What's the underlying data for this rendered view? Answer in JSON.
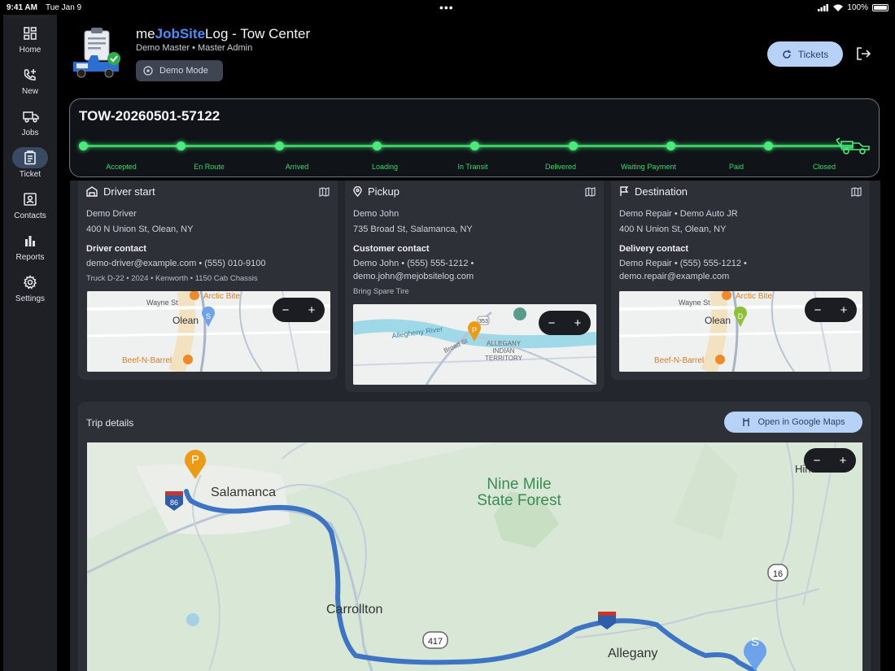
{
  "status_bar": {
    "time": "9:41 AM",
    "date": "Tue Jan 9",
    "battery": "100%"
  },
  "sidebar": {
    "items": [
      {
        "label": "Home",
        "icon": "grid-icon"
      },
      {
        "label": "New",
        "icon": "phone-plus-icon"
      },
      {
        "label": "Jobs",
        "icon": "truck-icon"
      },
      {
        "label": "Ticket",
        "icon": "clipboard-icon"
      },
      {
        "label": "Contacts",
        "icon": "contacts-icon"
      },
      {
        "label": "Reports",
        "icon": "bar-chart-icon"
      },
      {
        "label": "Settings",
        "icon": "gear-icon"
      }
    ],
    "active": "Ticket"
  },
  "header": {
    "title_prefix": "me",
    "title_brand": "JobSite",
    "title_suffix": "Log - Tow Center",
    "subtitle": "Demo Master • Master Admin",
    "demo_button": "Demo Mode",
    "tickets_button": "Tickets"
  },
  "ticket": {
    "id": "TOW-20260501-57122",
    "steps": [
      "Accepted",
      "En Route",
      "Arrived",
      "Loading",
      "In Transit",
      "Delivered",
      "Waiting Payment",
      "Paid",
      "Closed"
    ],
    "status_color": "#3ccd67"
  },
  "cards": {
    "driver": {
      "title": "Driver start",
      "name": "Demo Driver",
      "address": "400 N Union St, Olean, NY",
      "contact_heading": "Driver contact",
      "contact_line": "demo-driver@example.com • (555) 010-9100",
      "vehicle": "Truck D-22 • 2024 • Kenworth • 1150 Cab Chassis",
      "map_labels": [
        "Wayne St",
        "Arctic Bite",
        "Olean",
        "Beef-N-Barrel"
      ],
      "pin": "S"
    },
    "pickup": {
      "title": "Pickup",
      "name": "Demo John",
      "address": "735 Broad St, Salamanca, NY",
      "contact_heading": "Customer contact",
      "contact_line1": "Demo John • (555) 555-1212 •",
      "contact_line2": "demo.john@mejobsitelog.com",
      "note": "Bring Spare Tire",
      "map_labels": [
        "Allegheny River",
        "Broad St",
        "ALLEGANY",
        "INDIAN",
        "TERRITORY",
        "353"
      ],
      "pin": "P"
    },
    "destination": {
      "title": "Destination",
      "name": "Demo Repair • Demo Auto JR",
      "address": "400 N Union St, Olean, NY",
      "contact_heading": "Delivery contact",
      "contact_line1": "Demo Repair • (555) 555-1212 •",
      "contact_line2": "demo.repair@example.com",
      "map_labels": [
        "Wayne St",
        "Arctic Bite",
        "Olean",
        "Beef-N-Barrel"
      ],
      "pin": "D"
    }
  },
  "trip": {
    "title": "Trip details",
    "maps_button": "Open in Google Maps",
    "map_labels": {
      "forest": "Nine Mile",
      "forest2": "State Forest",
      "salamanca": "Salamanca",
      "carrollton": "Carrollton",
      "allegany": "Allegany",
      "hinsdale": "Hinsdale",
      "r417": "417",
      "r16": "16",
      "i86": "86"
    },
    "pins": {
      "start": "P",
      "end": "S"
    }
  },
  "colors": {
    "accent": "#4d8df7",
    "green": "#3ccd67",
    "route": "#3d74c4",
    "pickup_pin": "#ec9b19",
    "start_pin": "#6ea3ec",
    "dest_pin": "#8fc03a"
  }
}
